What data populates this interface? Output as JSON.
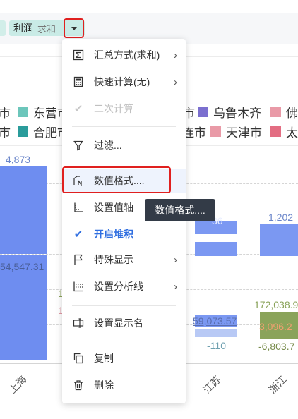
{
  "field": {
    "name": "利润",
    "aggregation": "求和"
  },
  "legend": {
    "row1": [
      {
        "label": "市",
        "color": ""
      },
      {
        "label": "东营市",
        "color": "#6cc6bb"
      },
      {
        "label": "市",
        "color": ""
      },
      {
        "label": "乌鲁木齐",
        "color": "#7b6fcf"
      },
      {
        "label": "佛",
        "color": "#e99aa7"
      }
    ],
    "row2": [
      {
        "label": "市",
        "color": ""
      },
      {
        "label": "合肥市",
        "color": "#2a9c9b"
      },
      {
        "label": "连市",
        "color": ""
      },
      {
        "label": "天津市",
        "color": "#e99aa7"
      },
      {
        "label": "太",
        "color": "#e36d82"
      }
    ]
  },
  "chart_labels": {
    "shanghai_top": "4,873",
    "shanghai_mid": "54,547.31",
    "jiangsu_top": "36",
    "jiangsu_mid": "59,073.57",
    "jiangsu_neg": "-110",
    "zhejiang_top": "1,202",
    "zhejiang_green": "172,038.9",
    "zhejiang_orange": "3,096.2",
    "zhejiang_neg": "-6,803.7",
    "partial_1": "1",
    "partial_2": "1"
  },
  "x_axis": {
    "shanghai": "上海",
    "jiangsu": "江苏",
    "zhejiang": "浙江"
  },
  "menu": {
    "items": [
      {
        "label": "汇总方式(求和)",
        "icon": "sigma-icon"
      },
      {
        "label": "快速计算(无)",
        "icon": "calculator-icon"
      },
      {
        "label": "二次计算",
        "icon": "check-icon"
      },
      {
        "label": "过滤...",
        "icon": "filter-icon"
      },
      {
        "label": "数值格式....",
        "icon": "number-format-icon"
      },
      {
        "label": "设置值轴",
        "icon": "axis-icon"
      },
      {
        "label": "开启堆积",
        "icon": "check-icon"
      },
      {
        "label": "特殊显示",
        "icon": "flag-icon"
      },
      {
        "label": "设置分析线",
        "icon": "analysis-line-icon"
      },
      {
        "label": "设置显示名",
        "icon": "rename-icon"
      },
      {
        "label": "复制",
        "icon": "copy-icon"
      },
      {
        "label": "删除",
        "icon": "trash-icon"
      }
    ]
  },
  "tooltip": "数值格式...."
}
